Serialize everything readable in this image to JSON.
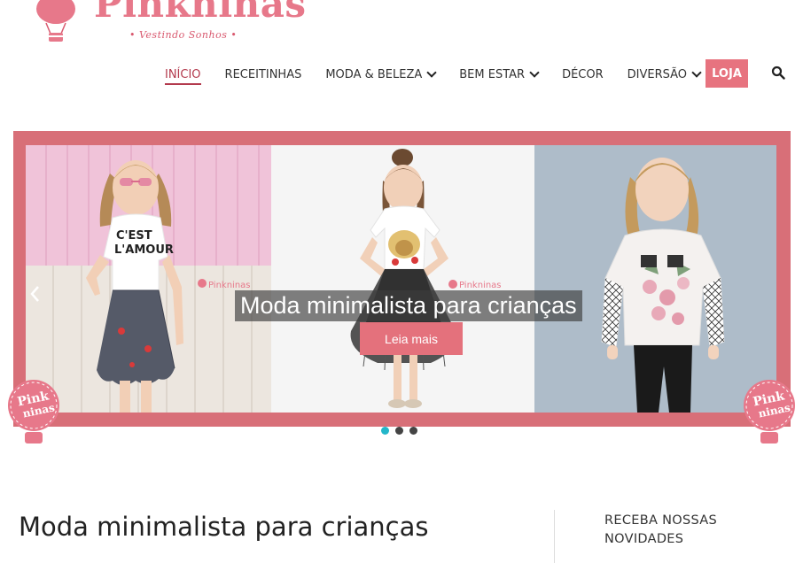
{
  "logo": {
    "name": "Pinkninas",
    "tagline": "• Vestindo Sonhos •",
    "color": "#e7788a"
  },
  "nav": {
    "items": [
      {
        "label": "INÍCIO",
        "active": true,
        "dropdown": false
      },
      {
        "label": "RECEITINHAS",
        "active": false,
        "dropdown": false
      },
      {
        "label": "MODA & BELEZA",
        "active": false,
        "dropdown": true
      },
      {
        "label": "BEM ESTAR",
        "active": false,
        "dropdown": true
      },
      {
        "label": "DÉCOR",
        "active": false,
        "dropdown": false
      },
      {
        "label": "DIVERSÃO",
        "active": false,
        "dropdown": true
      }
    ],
    "shop_button": "LOJA",
    "search_icon": "search-icon"
  },
  "slider": {
    "caption": "Moda minimalista para crianças",
    "cta_label": "Leia mais",
    "prev_icon": "chevron-left-icon",
    "next_icon": "chevron-right-icon",
    "badge_text": [
      "Pink",
      "ninas"
    ],
    "watermark": "Pinkninas",
    "shirt_text": [
      "C'EST",
      "L'AMOUR"
    ],
    "dots": 3,
    "active_dot": 0,
    "frame_color": "#d86f78",
    "accent_dot_color": "#23b6c9"
  },
  "article": {
    "title": "Moda minimalista para crianças"
  },
  "sidebar": {
    "newsletter_title": "RECEBA NOSSAS NOVIDADES"
  }
}
